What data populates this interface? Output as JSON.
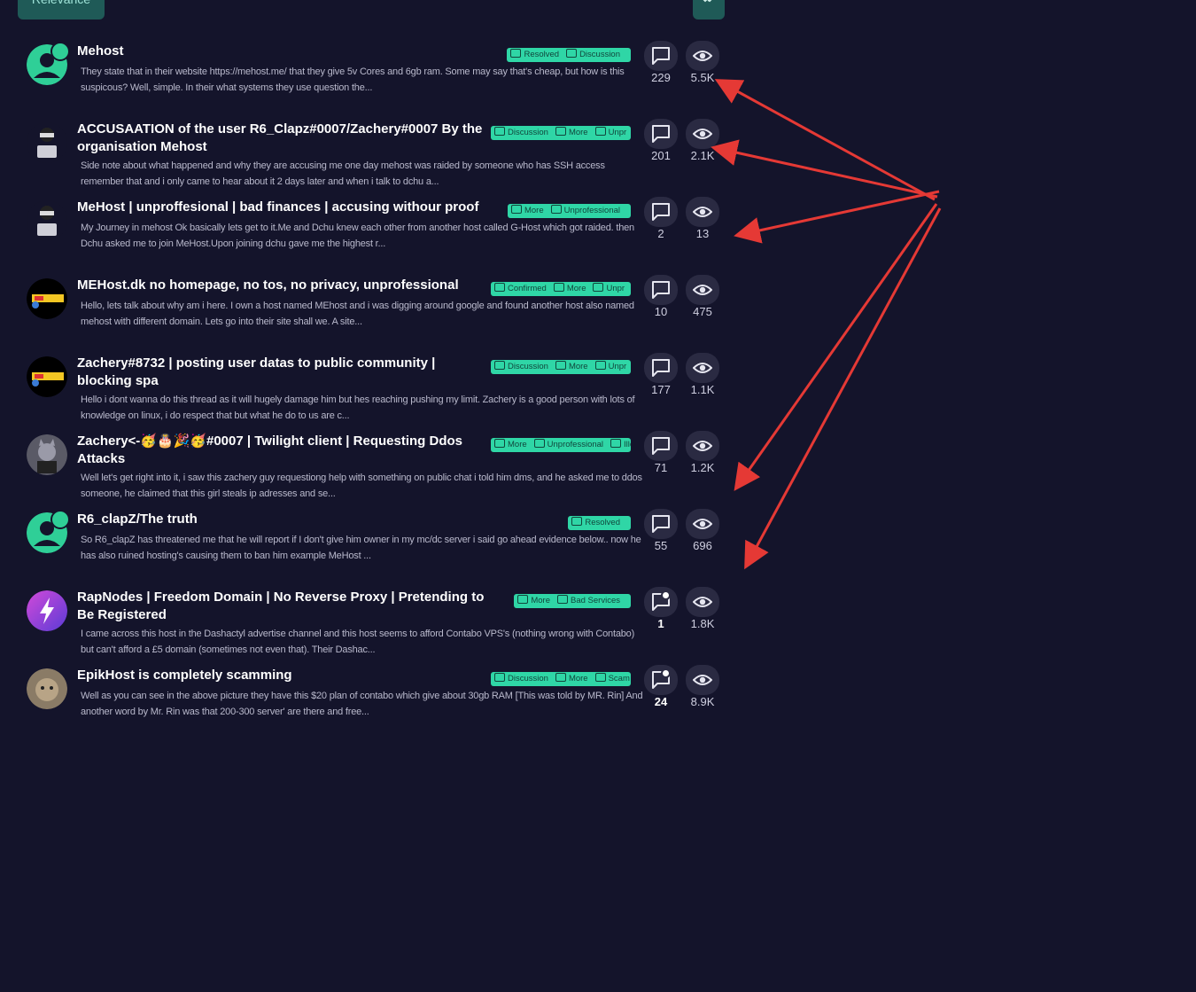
{
  "toolbar": {
    "sort_label": "Relevance"
  },
  "threads": [
    {
      "title": "Mehost",
      "excerpt": "They state that in their website https://mehost.me/ that they give 5v Cores and 6gb ram. Some may say that's cheap, but how is this suspicous? Well, simple. In their what systems they use question the...",
      "tags": [
        "Resolved",
        "Discussion"
      ],
      "replies": "229",
      "views": "5.5K",
      "avatar": "default-user-icon"
    },
    {
      "title": "ACCUSAATION of the user R6_Clapz#0007/Zachery#0007 By the organisation Mehost",
      "excerpt": "Side note about what happened and why they are accusing me one day mehost was raided by someone who has SSH access remember that and i only came to hear about it 2 days later and when i talk to dchu a...",
      "tags": [
        "Discussion",
        "More",
        "Unpr"
      ],
      "replies": "201",
      "views": "2.1K",
      "avatar": "hacker-laptop-avatar"
    },
    {
      "title": "MeHost | unproffesional | bad finances | accusing withour proof",
      "excerpt": "My Journey in mehost Ok basically lets get to it.Me and Dchu knew each other from another host called G-Host which got raided. then Dchu asked me to join MeHost.Upon joining dchu gave me the highest r...",
      "tags": [
        "More",
        "Unprofessional"
      ],
      "replies": "2",
      "views": "13",
      "avatar": "hacker-laptop-avatar"
    },
    {
      "title": "MEHost.dk no homepage, no tos, no privacy, unprofessional",
      "excerpt": "Hello, lets talk about why am i here. I own a host named MEhost and i was digging around google and found another host also named mehost with different domain. Lets go into their site shall we. A site...",
      "tags": [
        "Confirmed",
        "More",
        "Unpr"
      ],
      "replies": "10",
      "views": "475",
      "avatar": "logo-avatar"
    },
    {
      "title": "Zachery#8732 | posting user datas to public community | blocking spa",
      "excerpt": "Hello i dont wanna do this thread as it will hugely damage him but hes reaching pushing my limit. Zachery is a good person with lots of knowledge on linux, i do respect that but what he do to us are c...",
      "tags": [
        "Discussion",
        "More",
        "Unpr"
      ],
      "replies": "177",
      "views": "1.1K",
      "avatar": "logo-avatar"
    },
    {
      "title": "Zachery<-🥳🎂🎉🥳#0007 | Twilight client | Requesting Ddos Attacks",
      "excerpt": "Well let's get right into it, i saw this zachery guy requestiong help with something on public chat i told him dms, and he asked me to ddos someone, he claimed that this girl steals ip adresses and se...",
      "tags": [
        "More",
        "Unprofessional",
        "Illeg"
      ],
      "replies": "71",
      "views": "1.2K",
      "avatar": "cat-avatar"
    },
    {
      "title": "R6_clapZ/The truth",
      "excerpt": "So R6_clapZ has threatened me that he will report if I don't give him owner in my mc/dc server i said go ahead evidence below.. now he has also ruined hosting's causing them to ban him example MeHost ...",
      "tags": [
        "Resolved"
      ],
      "replies": "55",
      "views": "696",
      "avatar": "default-user-icon"
    },
    {
      "title": "RapNodes | Freedom Domain | No Reverse Proxy | Pretending to Be Registered",
      "excerpt": "I came across this host in the Dashactyl advertise channel and this host seems to afford Contabo VPS's (nothing wrong with Contabo) but can't afford a £5 domain (sometimes not even that). Their Dashac...",
      "tags": [
        "More",
        "Bad Services"
      ],
      "replies": "1",
      "views": "1.8K",
      "avatar": "lightning-avatar",
      "unread": true
    },
    {
      "title": "EpikHost is completely scamming",
      "excerpt": "Well as you can see in the above picture they have this $20 plan of contabo which give about 30gb RAM [This was told by MR. Rin] And another word by Mr. Rin was that 200-300 server' are there and free...",
      "tags": [
        "Discussion",
        "More",
        "Scam"
      ],
      "replies": "24",
      "views": "8.9K",
      "avatar": "cat-photo-avatar",
      "unread": true
    }
  ],
  "colors": {
    "background": "#14142b",
    "tag_bg": "#2fd6a6",
    "annotation_arrow": "#e53935"
  }
}
